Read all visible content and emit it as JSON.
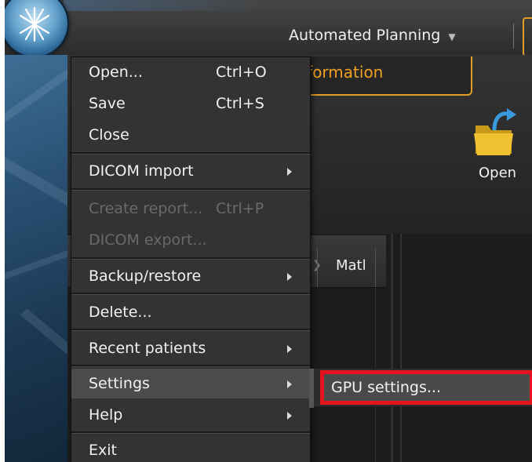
{
  "header": {
    "workflow_label": "Automated Planning",
    "workflow_caret": "▼"
  },
  "ribbon": {
    "active_tab": "tient Information",
    "open_label": "Open"
  },
  "list": {
    "matl_header": "Matl"
  },
  "menu": {
    "items": [
      {
        "label": "Open...",
        "shortcut": "Ctrl+O"
      },
      {
        "label": "Save",
        "shortcut": "Ctrl+S"
      },
      {
        "label": "Close"
      },
      {
        "label": "DICOM import"
      },
      {
        "label": "Create report...",
        "shortcut": "Ctrl+P"
      },
      {
        "label": "DICOM export..."
      },
      {
        "label": "Backup/restore"
      },
      {
        "label": "Delete..."
      },
      {
        "label": "Recent patients"
      },
      {
        "label": "Settings"
      },
      {
        "label": "Help"
      },
      {
        "label": "Exit"
      }
    ]
  },
  "submenu": {
    "gpu_settings": "GPU settings..."
  },
  "colors": {
    "accent_orange": "#e09e28",
    "highlight_red": "#e3141e",
    "menu_bg": "#333333"
  }
}
